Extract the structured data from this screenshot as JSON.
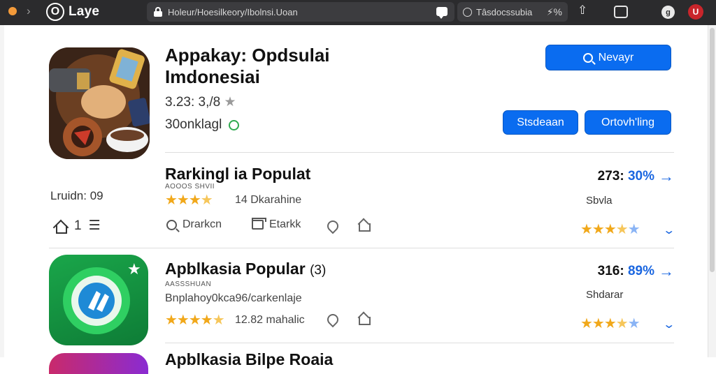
{
  "browser": {
    "brand": "Laye",
    "brand_mark": "O",
    "url": "Holeur/Hoesilkeory/Ibolnsi.Uoan",
    "info_pill": "Tâsdocssubia",
    "tools_glyph": "⚡%",
    "profile_letter": "g",
    "extension_letter": "U"
  },
  "app": {
    "title": "Appakay: Opdsulai Imdonesiai",
    "rating": "3.23: 3,/8",
    "rating_star": "★",
    "developer": "30onklagl",
    "search_button": "Nevayr",
    "button_a": "Stsdeaan",
    "button_b": "Ortovh'ling"
  },
  "left_panel": {
    "label": "Lruidn: 09",
    "count": "1"
  },
  "rows": [
    {
      "title": "Rarkingl ia Populat",
      "subtitle": "AOOOS SHVII",
      "stars": "★★★",
      "stars_half": "★",
      "stars_empty": "",
      "meta": "14 Dkarahine",
      "rank_number": "273:",
      "rank_pct": "30%",
      "rank_label": "Sbvla",
      "stars_right": "★★★",
      "stars_right_half": "★",
      "stars_right_empty": "★",
      "actions": [
        "Drarkcn",
        "Etarkk"
      ]
    },
    {
      "title": "Apblkasia Popular",
      "title_count": "(3)",
      "subtitle": "AASSSHUAN",
      "description": "Bnplahoy0kca96/carkenlaje",
      "stars": "★★★★",
      "stars_half": "★",
      "meta": "12.82 mahalic",
      "rank_number": "316:",
      "rank_pct": "89%",
      "rank_label": "Shdarar",
      "stars_right": "★★★",
      "stars_right_half": "★",
      "stars_right_empty": "★"
    }
  ],
  "peek_row": {
    "title": "Apblkasia Bilpe Roaia"
  },
  "colors": {
    "accent": "#0a6cf0",
    "chrome": "#2b2b2d",
    "star": "#f1a81a"
  }
}
